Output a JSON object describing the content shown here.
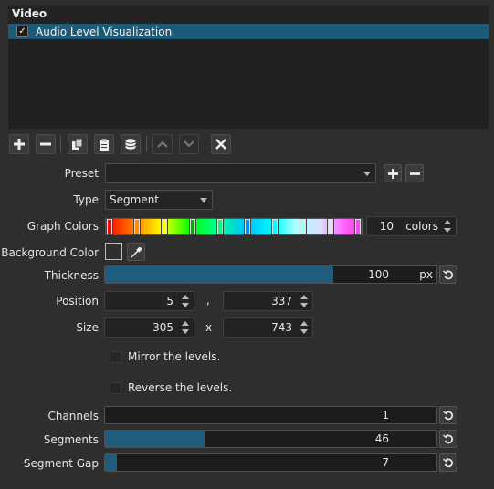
{
  "panel": {
    "title": "Video",
    "filters": [
      {
        "label": "Audio Level Visualization",
        "checked": true,
        "check_glyph": "✓"
      }
    ]
  },
  "toolbar": {
    "buttons": [
      {
        "name": "add-filter-button",
        "icon": "plus-icon"
      },
      {
        "name": "remove-filter-button",
        "icon": "minus-icon"
      },
      {
        "name": "copy-filter-button",
        "icon": "copy-icon"
      },
      {
        "name": "paste-filter-button",
        "icon": "paste-icon"
      },
      {
        "name": "save-filter-set-button",
        "icon": "database-icon"
      },
      {
        "name": "move-up-button",
        "icon": "chevron-up-icon"
      },
      {
        "name": "move-down-button",
        "icon": "chevron-down-icon"
      },
      {
        "name": "deselect-filter-button",
        "icon": "close-icon"
      }
    ]
  },
  "preset": {
    "label": "Preset",
    "value": ""
  },
  "type": {
    "label": "Type",
    "value": "Segment"
  },
  "graph_colors": {
    "label": "Graph Colors",
    "count": "10",
    "unit": "colors",
    "stops": [
      "#ff0000",
      "#ff8c00",
      "#ffff00",
      "#00b000",
      "#00ff80",
      "#0090ff",
      "#00ffff",
      "#a0ffff",
      "#e0e0ff",
      "#ff40ff"
    ]
  },
  "background_color": {
    "label": "Background Color",
    "value": "#2e2e2e"
  },
  "thickness": {
    "label": "Thickness",
    "value": "100",
    "unit": "px",
    "fraction": 0.69
  },
  "position": {
    "label": "Position",
    "x": "5",
    "separator": ",",
    "y": "337"
  },
  "size": {
    "label": "Size",
    "width": "305",
    "separator": "x",
    "height": "743"
  },
  "mirror": {
    "label": "Mirror the levels.",
    "checked": false
  },
  "reverse": {
    "label": "Reverse the levels.",
    "checked": false
  },
  "channels": {
    "label": "Channels",
    "value": "1",
    "fraction": 0.0
  },
  "segments": {
    "label": "Segments",
    "value": "46",
    "fraction": 0.3
  },
  "segment_gap": {
    "label": "Segment Gap",
    "value": "7",
    "fraction": 0.035
  }
}
